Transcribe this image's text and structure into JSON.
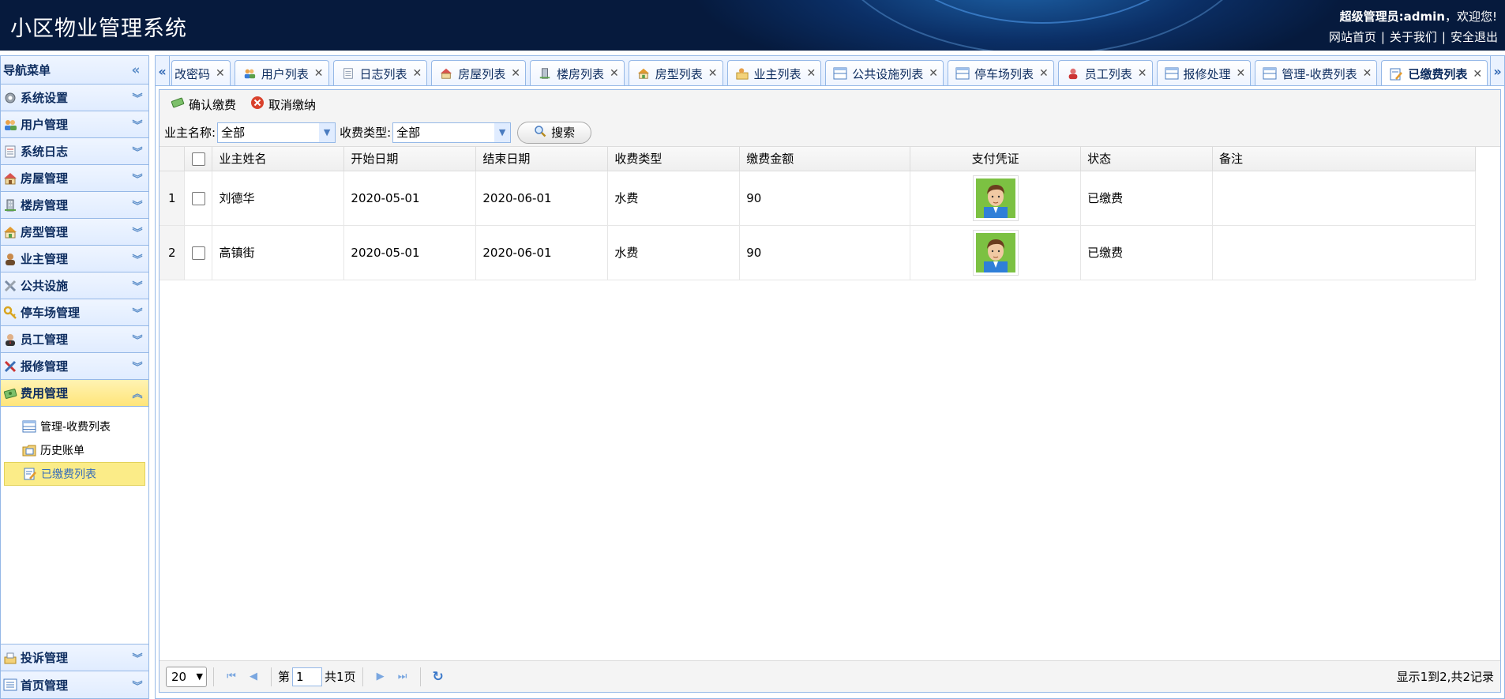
{
  "header": {
    "app_title": "小区物业管理系统",
    "user_role": "超级管理员:",
    "user_name": "admin",
    "welcome": "，欢迎您!",
    "links": [
      "网站首页",
      "关于我们",
      "安全退出"
    ],
    "separator": "|"
  },
  "sidebar": {
    "title": "导航菜单",
    "items": [
      {
        "label": "系统设置",
        "icon": "gear-icon"
      },
      {
        "label": "用户管理",
        "icon": "users-icon"
      },
      {
        "label": "系统日志",
        "icon": "log-icon"
      },
      {
        "label": "房屋管理",
        "icon": "house-icon"
      },
      {
        "label": "楼房管理",
        "icon": "building-icon"
      },
      {
        "label": "房型管理",
        "icon": "house-type-icon"
      },
      {
        "label": "业主管理",
        "icon": "owner-icon"
      },
      {
        "label": "公共设施",
        "icon": "tools-icon"
      },
      {
        "label": "停车场管理",
        "icon": "key-icon"
      },
      {
        "label": "员工管理",
        "icon": "staff-icon"
      },
      {
        "label": "报修管理",
        "icon": "repair-icon"
      },
      {
        "label": "费用管理",
        "icon": "money-icon"
      }
    ],
    "sub_items": [
      {
        "label": "管理-收费列表",
        "icon": "table-icon"
      },
      {
        "label": "历史账单",
        "icon": "folder-icon"
      },
      {
        "label": "已缴费列表",
        "icon": "edit-icon"
      }
    ],
    "bottom_items": [
      {
        "label": "投诉管理",
        "icon": "complaint-icon"
      },
      {
        "label": "首页管理",
        "icon": "home-list-icon"
      }
    ]
  },
  "tabs": [
    {
      "label": "改密码"
    },
    {
      "label": "用户列表"
    },
    {
      "label": "日志列表"
    },
    {
      "label": "房屋列表"
    },
    {
      "label": "楼房列表"
    },
    {
      "label": "房型列表"
    },
    {
      "label": "业主列表"
    },
    {
      "label": "公共设施列表"
    },
    {
      "label": "停车场列表"
    },
    {
      "label": "员工列表"
    },
    {
      "label": "报修处理"
    },
    {
      "label": "管理-收费列表"
    },
    {
      "label": "已缴费列表"
    }
  ],
  "toolbar": {
    "confirm_label": "确认缴费",
    "cancel_label": "取消缴纳"
  },
  "search": {
    "owner_label": "业主名称:",
    "owner_value": "全部",
    "type_label": "收费类型:",
    "type_value": "全部",
    "button_label": "搜索"
  },
  "grid": {
    "columns": [
      "业主姓名",
      "开始日期",
      "结束日期",
      "收费类型",
      "缴费金额",
      "支付凭证",
      "状态",
      "备注"
    ],
    "rows": [
      {
        "num": "1",
        "owner": "刘德华",
        "start": "2020-05-01",
        "end": "2020-06-01",
        "type": "水费",
        "amount": "90",
        "status": "已缴费",
        "note": ""
      },
      {
        "num": "2",
        "owner": "高镇街",
        "start": "2020-05-01",
        "end": "2020-06-01",
        "type": "水费",
        "amount": "90",
        "status": "已缴费",
        "note": ""
      }
    ]
  },
  "pager": {
    "page_size": "20",
    "page_prefix": "第",
    "page_value": "1",
    "page_total": "共1页",
    "info": "显示1到2,共2记录"
  }
}
